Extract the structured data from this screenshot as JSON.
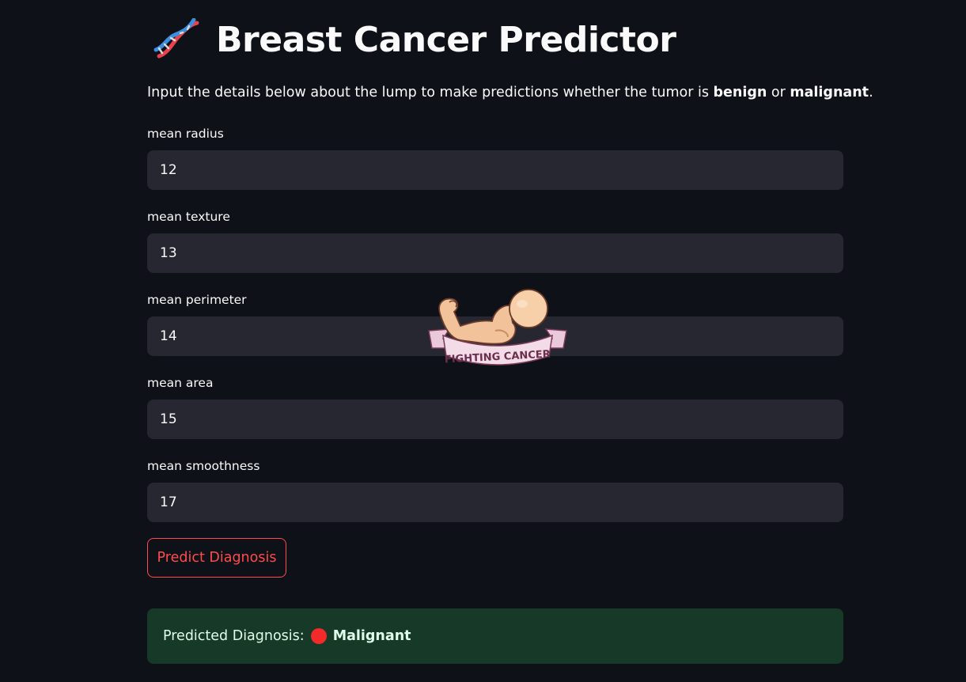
{
  "header": {
    "icon": "dna-icon",
    "title": "Breast Cancer Predictor"
  },
  "intro": {
    "prefix": "Input the details below about the lump to make predictions whether the tumor is ",
    "benign": "benign",
    "or": " or ",
    "malignant": "malignant",
    "suffix": "."
  },
  "fields": [
    {
      "label": "mean radius",
      "value": "12"
    },
    {
      "label": "mean texture",
      "value": "13"
    },
    {
      "label": "mean perimeter",
      "value": "14"
    },
    {
      "label": "mean area",
      "value": "15"
    },
    {
      "label": "mean smoothness",
      "value": "17"
    }
  ],
  "button": {
    "label": "Predict Diagnosis",
    "color": "#ff4b4b"
  },
  "result": {
    "prefix": "Predicted Diagnosis:",
    "status_color": "#f22a2a",
    "diagnosis": "Malignant",
    "background": "#173928"
  },
  "sticker": {
    "icon": "flexing-arm-icon",
    "text": "FIGHTING CANCER"
  }
}
